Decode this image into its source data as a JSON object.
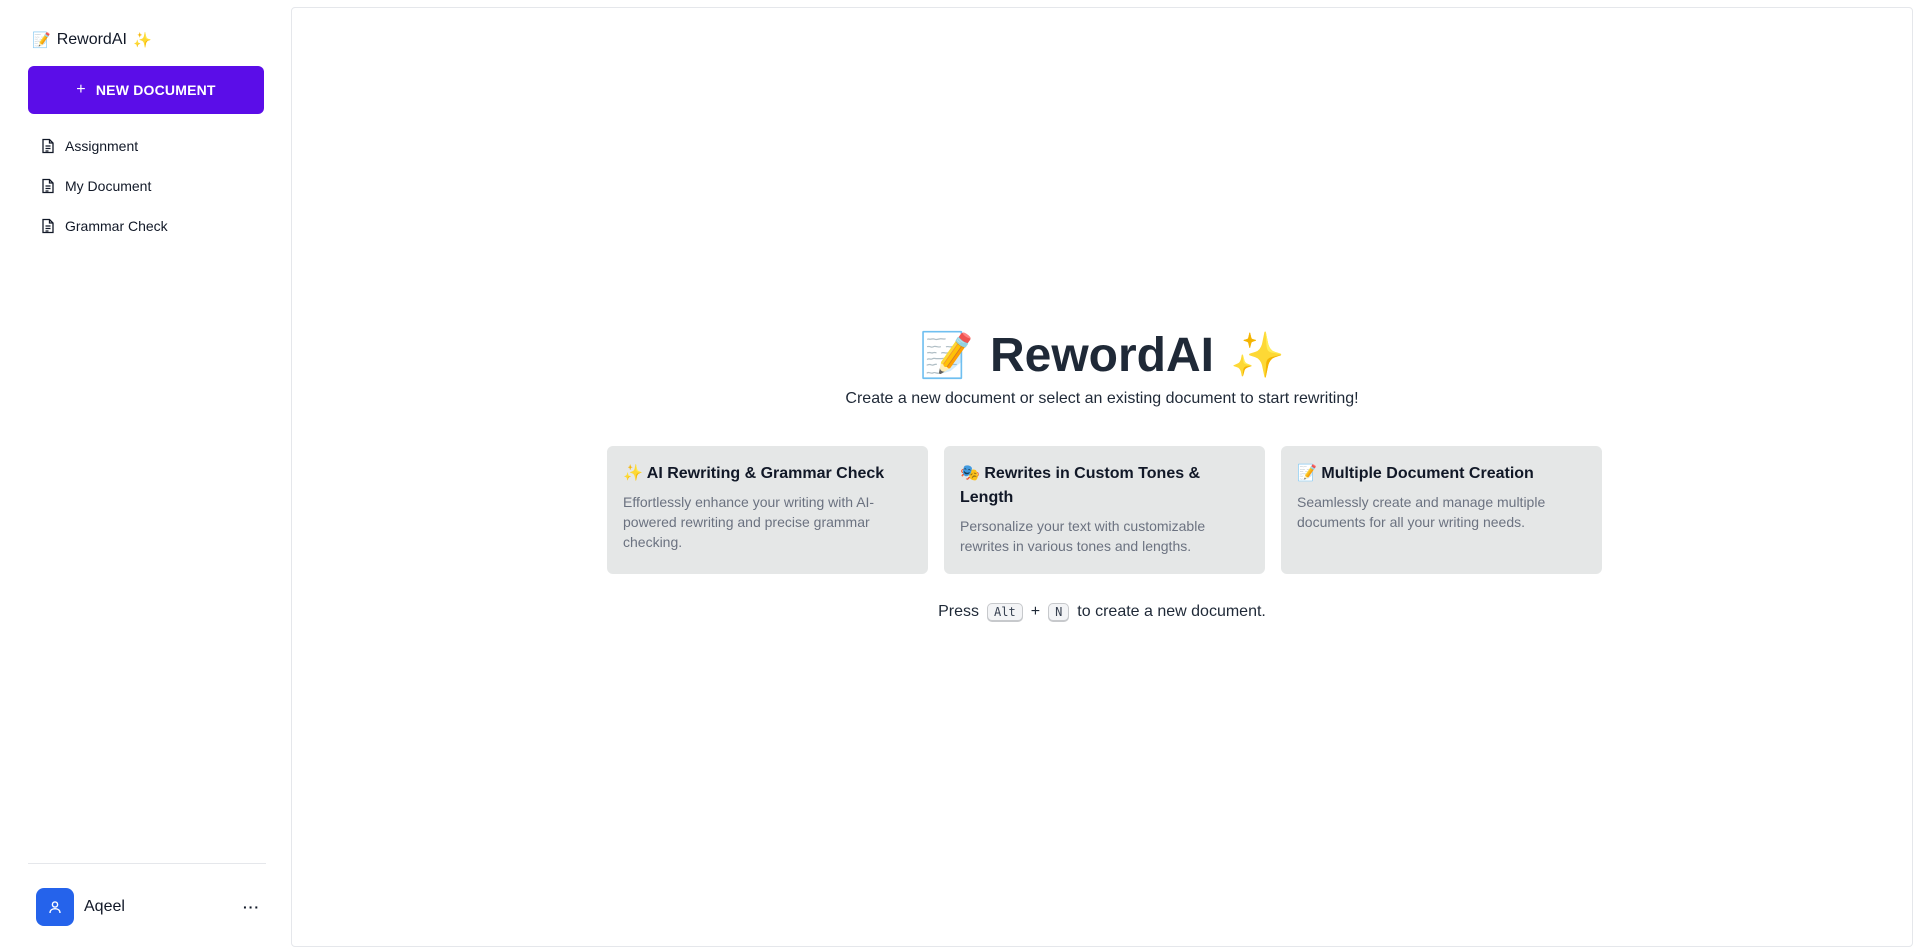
{
  "sidebar": {
    "brand": {
      "name": "RewordAI",
      "emoji_left": "📝",
      "emoji_right": "✨"
    },
    "new_document": {
      "icon": "+",
      "label": "NEW DOCUMENT"
    },
    "documents": [
      {
        "label": "Assignment",
        "icon": "document-icon"
      },
      {
        "label": "My Document",
        "icon": "document-icon"
      },
      {
        "label": "Grammar Check",
        "icon": "document-icon"
      }
    ],
    "user": {
      "name": "Aqeel",
      "icon": "user-icon",
      "more": "···"
    }
  },
  "main": {
    "hero": {
      "emoji_left": "📝",
      "title": "RewordAI",
      "emoji_right": "✨",
      "subtitle": "Create a new document or select an existing document to start rewriting!"
    },
    "features": [
      {
        "emoji": "✨",
        "title": "AI Rewriting & Grammar Check",
        "description": "Effortlessly enhance your writing with AI-powered rewriting and precise grammar checking."
      },
      {
        "emoji": "🎭",
        "title": "Rewrites in Custom Tones & Length",
        "description": "Personalize your text with customizable rewrites in various tones and lengths."
      },
      {
        "emoji": "📝",
        "title": "Multiple Document Creation",
        "description": "Seamlessly create and manage multiple documents for all your writing needs."
      }
    ],
    "shortcut": {
      "prefix": "Press",
      "key1": "Alt",
      "plus": "+",
      "key2": "N",
      "suffix": "to create a new document."
    }
  },
  "colors": {
    "accent": "#5b0de8",
    "avatar": "#2563eb",
    "card_bg": "#e5e7e7"
  }
}
